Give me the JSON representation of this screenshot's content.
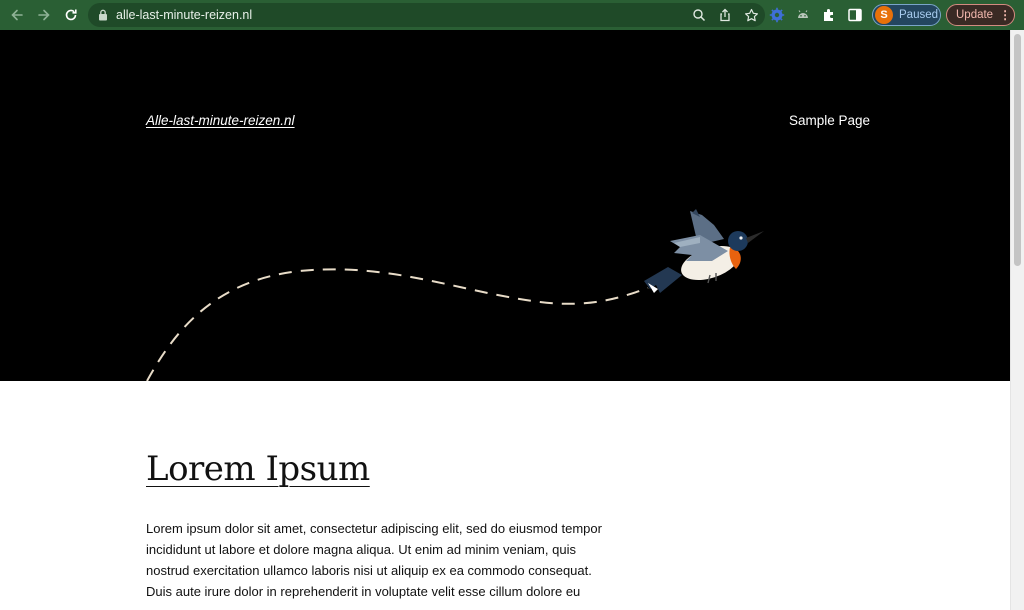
{
  "browser": {
    "url": "alle-last-minute-reizen.nl",
    "profile_initial": "S",
    "profile_status": "Paused",
    "update_label": "Update",
    "icons": [
      "back-icon",
      "forward-icon",
      "reload-icon",
      "lock-icon",
      "zoom-icon",
      "share-icon",
      "star-icon",
      "extension-gear-icon",
      "extension-android-icon",
      "puzzle-icon",
      "sidepanel-icon",
      "menu-dots-icon"
    ]
  },
  "site": {
    "title": "Alle-last-minute-reizen.nl",
    "nav": [
      "Sample Page"
    ]
  },
  "post": {
    "title": "Lorem Ipsum",
    "body": "Lorem ipsum dolor sit amet, consectetur adipiscing elit, sed do eiusmod tempor incididunt ut labore et dolore magna aliqua. Ut enim ad minim veniam, quis nostrud exercitation ullamco laboris nisi ut aliquip ex ea commodo consequat. Duis aute irure dolor in reprehenderit in voluptate velit esse cillum dolore eu"
  },
  "colors": {
    "chrome_bg": "#2a5f34",
    "hero_bg": "#000000",
    "path_dash": "#e8dcc8",
    "bird_breast": "#e8620f",
    "bird_head": "#1d3a5c"
  }
}
